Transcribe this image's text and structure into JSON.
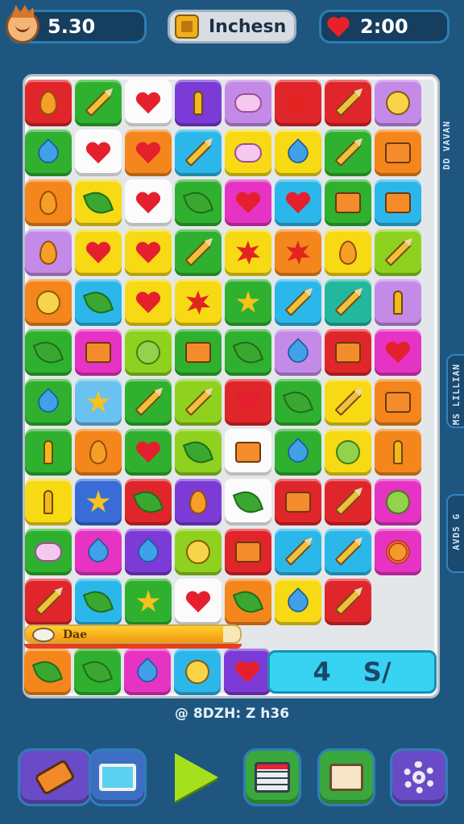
{
  "hud": {
    "score": "5.30",
    "level_label": "Inchesn",
    "timer": "2:00",
    "avatar_icon": "player-avatar-icon",
    "level_icon": "level-badge-icon",
    "timer_icon": "heart-icon"
  },
  "board": {
    "rows": [
      [
        [
          "c-red",
          "seed"
        ],
        [
          "c-green",
          "pencil"
        ],
        [
          "c-white",
          "heart"
        ],
        [
          "c-purple",
          "key"
        ],
        [
          "c-lilac",
          "cloud"
        ],
        [
          "c-red",
          "burst"
        ],
        [
          "c-red",
          "pencil"
        ],
        [
          "c-lilac",
          "face"
        ]
      ],
      [
        [
          "c-green",
          "drop"
        ],
        [
          "c-white",
          "heart"
        ],
        [
          "c-orange",
          "heart"
        ],
        [
          "c-sky",
          "pencil"
        ],
        [
          "c-yellow",
          "cloud"
        ],
        [
          "c-yellow",
          "drop"
        ],
        [
          "c-green",
          "pencil"
        ],
        [
          "c-orange",
          "box"
        ]
      ],
      [
        [
          "c-orange",
          "seed"
        ],
        [
          "c-yellow",
          "leaf"
        ],
        [
          "c-white",
          "heart"
        ],
        [
          "c-green",
          "leaf"
        ],
        [
          "c-magenta",
          "heart"
        ],
        [
          "c-sky",
          "heart"
        ],
        [
          "c-green",
          "box"
        ],
        [
          "c-sky",
          "box"
        ]
      ],
      [
        [
          "c-lilac",
          "seed"
        ],
        [
          "c-yellow",
          "heart"
        ],
        [
          "c-yellow",
          "heart"
        ],
        [
          "c-green",
          "pencil"
        ],
        [
          "c-yellow",
          "burst"
        ],
        [
          "c-orange",
          "burst"
        ],
        [
          "c-yellow",
          "seed"
        ],
        [
          "c-lime",
          "pencil"
        ]
      ],
      [
        [
          "c-orange",
          "face"
        ],
        [
          "c-sky",
          "leaf"
        ],
        [
          "c-yellow",
          "heart"
        ],
        [
          "c-yellow",
          "burst"
        ],
        [
          "c-green",
          "star"
        ],
        [
          "c-sky",
          "pencil"
        ],
        [
          "c-teal",
          "pencil"
        ],
        [
          "c-lilac",
          "key"
        ]
      ],
      [
        [
          "c-green",
          "leaf"
        ],
        [
          "c-magenta",
          "box"
        ],
        [
          "c-lime",
          "round"
        ],
        [
          "c-green",
          "box"
        ],
        [
          "c-green",
          "leaf"
        ],
        [
          "c-lilac",
          "drop"
        ],
        [
          "c-red",
          "box"
        ],
        [
          "c-magenta",
          "heart"
        ]
      ],
      [
        [
          "c-green",
          "drop"
        ],
        [
          "c-ltblue",
          "star"
        ],
        [
          "c-green",
          "pencil"
        ],
        [
          "c-lime",
          "pencil"
        ],
        [
          "c-red",
          "heart"
        ],
        [
          "c-green",
          "leaf"
        ],
        [
          "c-yellow",
          "pencil"
        ],
        [
          "c-orange",
          "box"
        ]
      ],
      [
        [
          "c-green",
          "key"
        ],
        [
          "c-orange",
          "seed"
        ],
        [
          "c-green",
          "heart"
        ],
        [
          "c-lime",
          "leaf"
        ],
        [
          "c-white",
          "box"
        ],
        [
          "c-green",
          "drop"
        ],
        [
          "c-yellow",
          "round"
        ],
        [
          "c-orange",
          "key"
        ]
      ],
      [
        [
          "c-yellow",
          "key"
        ],
        [
          "c-blue",
          "star"
        ],
        [
          "c-red",
          "leaf"
        ],
        [
          "c-purple",
          "seed"
        ],
        [
          "c-white",
          "leaf"
        ],
        [
          "c-red",
          "box"
        ],
        [
          "c-red",
          "pencil"
        ],
        [
          "c-magenta",
          "round"
        ]
      ],
      [
        [
          "c-green",
          "cloud"
        ],
        [
          "c-magenta",
          "drop"
        ],
        [
          "c-purple",
          "drop"
        ],
        [
          "c-lime",
          "face"
        ],
        [
          "c-red",
          "box"
        ],
        [
          "c-sky",
          "pencil"
        ],
        [
          "c-sky",
          "pencil"
        ],
        [
          "c-magenta",
          "swirl"
        ]
      ],
      [
        [
          "c-red",
          "pencil"
        ],
        [
          "c-sky",
          "leaf"
        ],
        [
          "c-green",
          "star"
        ],
        [
          "c-white",
          "heart"
        ],
        [
          "c-orange",
          "leaf"
        ],
        [
          "c-yellow",
          "drop"
        ],
        [
          "c-red",
          "pencil"
        ]
      ]
    ],
    "bottom_tiles": [
      [
        "c-orange",
        "leaf"
      ],
      [
        "c-green",
        "leaf"
      ],
      [
        "c-magenta",
        "drop"
      ],
      [
        "c-sky",
        "face"
      ],
      [
        "c-purple",
        "heart"
      ]
    ],
    "side_label_top": "DD VAVAN",
    "side_label_mid": "MS LILLIAN",
    "side_label_low": "AVD5 G"
  },
  "progress": {
    "label": "Dae",
    "fraction": 0.92,
    "icon": "coin-icon"
  },
  "counter": {
    "left": "4",
    "right": "S/"
  },
  "version_text": "@ 8DZH: Z h36",
  "toolbar": {
    "phone_icon": "phone-icon",
    "monitor_icon": "monitor-icon",
    "play_icon": "play-icon",
    "stats_icon": "stats-board-icon",
    "map_icon": "map-icon",
    "gear_icon": "gear-icon"
  }
}
